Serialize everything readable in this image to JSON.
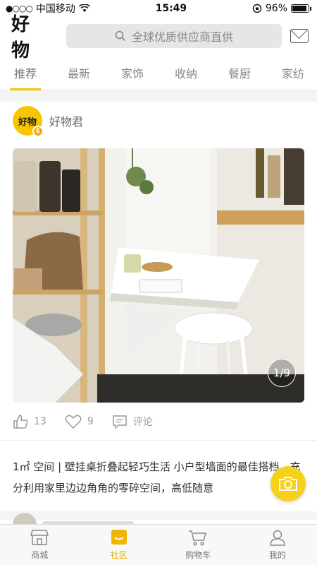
{
  "status_bar": {
    "signal": "●○○○",
    "carrier": "中国移动",
    "time": "15:49",
    "battery": "96%"
  },
  "header": {
    "logo": "好 物",
    "search_placeholder": "全球优质供应商直供"
  },
  "tabs": [
    {
      "label": "推荐",
      "active": true
    },
    {
      "label": "最新"
    },
    {
      "label": "家饰"
    },
    {
      "label": "收纳"
    },
    {
      "label": "餐厨"
    },
    {
      "label": "家纺"
    }
  ],
  "post": {
    "avatar_text": "好物",
    "avatar_badge": "E",
    "author": "好物君",
    "image_counter": "1/9",
    "likes": "13",
    "favorites": "9",
    "comment_label": "评论",
    "description": "1㎡ 空间 | 壁挂桌折叠起轻巧生活 小户型墙面的最佳搭档，充分利用家里边边角角的零碎空间，高低随意"
  },
  "bottom_nav": [
    {
      "label": "商城",
      "icon": "store-icon"
    },
    {
      "label": "社区",
      "icon": "community-icon",
      "active": true
    },
    {
      "label": "购物车",
      "icon": "cart-icon"
    },
    {
      "label": "我的",
      "icon": "profile-icon"
    }
  ],
  "colors": {
    "accent": "#f5c400",
    "active_nav": "#e0a800"
  }
}
